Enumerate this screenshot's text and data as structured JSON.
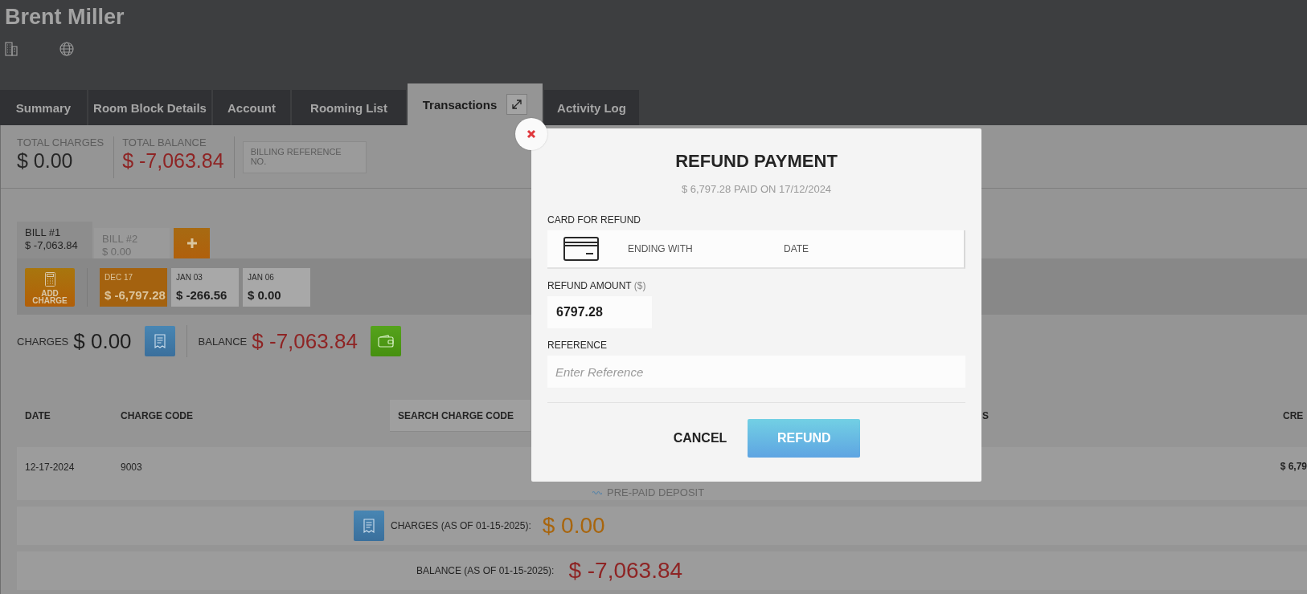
{
  "guest": {
    "name": "Brent Miller"
  },
  "tabs": [
    {
      "label": "Summary",
      "selected": false,
      "expandable": false
    },
    {
      "label": "Room Block Details",
      "selected": false,
      "expandable": false
    },
    {
      "label": "Account",
      "selected": false,
      "expandable": false
    },
    {
      "label": "Rooming List",
      "selected": false,
      "expandable": false
    },
    {
      "label": "Transactions",
      "selected": true,
      "expandable": true
    },
    {
      "label": "Activity Log",
      "selected": false,
      "expandable": false
    }
  ],
  "totals": [
    {
      "label": "TOTAL CHARGES",
      "value": "$ 0.00",
      "negative": false
    },
    {
      "label": "TOTAL BALANCE",
      "value": "$ -7,063.84",
      "negative": true
    }
  ],
  "billing_reference": {
    "label": "BILLING REFERENCE NO."
  },
  "bills": [
    {
      "label": "BILL #1",
      "amount": "$ -7,063.84",
      "selected": true
    },
    {
      "label": "BILL #2",
      "amount": "$ 0.00",
      "selected": false
    }
  ],
  "add_charge": {
    "label": "ADD CHARGE"
  },
  "payments": [
    {
      "date": "DEC 17",
      "amount": "$ -6,797.28",
      "selected": true
    },
    {
      "date": "JAN 03",
      "amount": "$ -266.56",
      "selected": false
    },
    {
      "date": "JAN 06",
      "amount": "$ 0.00",
      "selected": false
    }
  ],
  "bill_summary": {
    "charges_label": "CHARGES",
    "charges": "$ 0.00",
    "balance_label": "BALANCE",
    "balance": "$ -7,063.84"
  },
  "table": {
    "columns": [
      "DATE",
      "CHARGE CODE",
      "S",
      "CRE"
    ],
    "search": {
      "placeholder": "SEARCH CHARGE CODE"
    },
    "rows": [
      {
        "date": "12-17-2024",
        "code": "9003",
        "description": "PRE-PAID DEPOSIT",
        "credit": "$ 6,79"
      }
    ]
  },
  "summary_rows": [
    {
      "kind": "charges",
      "label": "CHARGES (AS OF 01-15-2025):",
      "value": "$ 0.00"
    },
    {
      "kind": "balance",
      "label": "BALANCE (AS OF 01-15-2025):",
      "value": "$ -7,063.84"
    }
  ],
  "modal": {
    "title": "REFUND PAYMENT",
    "subtitle": "$ 6,797.28 PAID ON 17/12/2024",
    "card_label": "CARD FOR REFUND",
    "card_columns": [
      "ENDING WITH",
      "DATE"
    ],
    "amount_label": "REFUND AMOUNT",
    "amount_unit": "($)",
    "amount_value": "6797.28",
    "reference_label": "REFERENCE",
    "reference_placeholder": "Enter Reference",
    "buttons": [
      {
        "label": "CANCEL",
        "kind": "secondary"
      },
      {
        "label": "REFUND",
        "kind": "primary"
      }
    ]
  }
}
